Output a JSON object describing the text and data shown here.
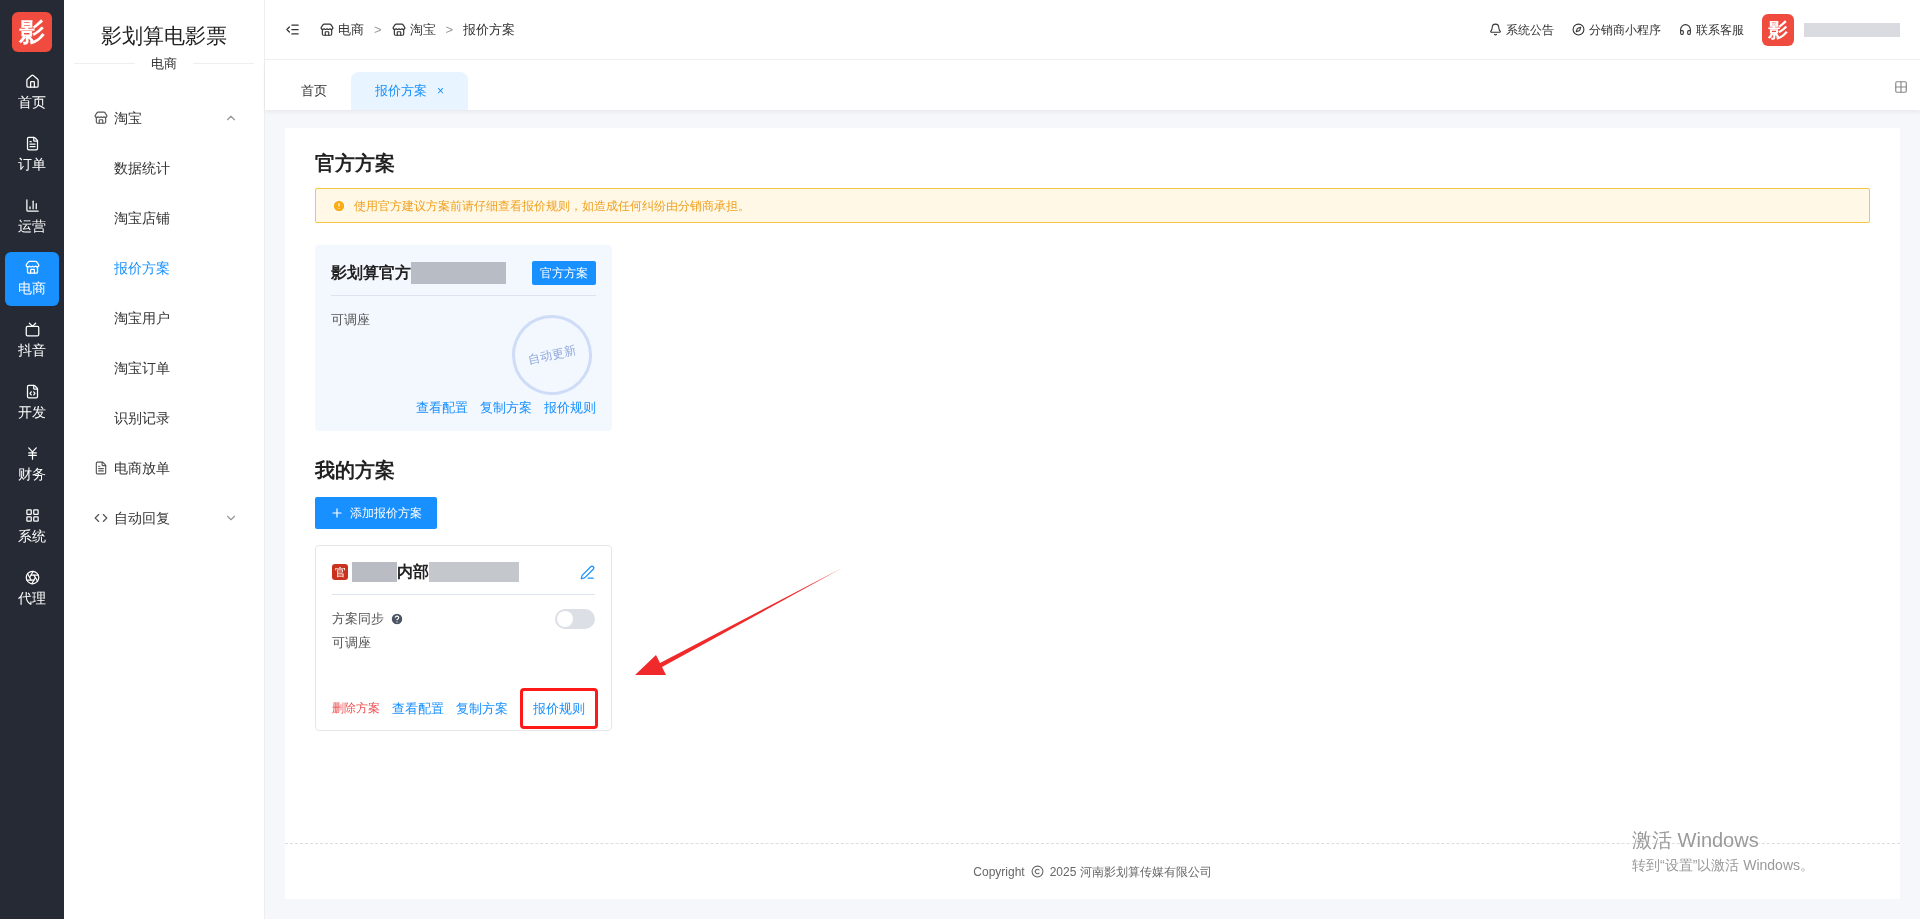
{
  "logo": "影",
  "rail": [
    {
      "label": "首页",
      "selected": false
    },
    {
      "label": "订单",
      "selected": false
    },
    {
      "label": "运营",
      "selected": false
    },
    {
      "label": "电商",
      "selected": true
    },
    {
      "label": "抖音",
      "selected": false
    },
    {
      "label": "开发",
      "selected": false
    },
    {
      "label": "财务",
      "selected": false
    },
    {
      "label": "系统",
      "selected": false
    },
    {
      "label": "代理",
      "selected": false
    }
  ],
  "brand": {
    "title": "影划算电影票",
    "subtitle": "电商"
  },
  "menu": [
    {
      "label": "淘宝",
      "kind": "group",
      "expanded": true,
      "children": [
        {
          "label": "数据统计",
          "selected": false
        },
        {
          "label": "淘宝店铺",
          "selected": false
        },
        {
          "label": "报价方案",
          "selected": true
        },
        {
          "label": "淘宝用户",
          "selected": false
        },
        {
          "label": "淘宝订单",
          "selected": false
        },
        {
          "label": "识别记录",
          "selected": false
        }
      ]
    },
    {
      "label": "电商放单",
      "kind": "link"
    },
    {
      "label": "自动回复",
      "kind": "group",
      "expanded": false
    }
  ],
  "breadcrumb": [
    {
      "label": "电商"
    },
    {
      "separator": ">",
      "label": "淘宝"
    },
    {
      "separator": ">",
      "label": "报价方案"
    }
  ],
  "header_links": [
    {
      "label": "系统公告"
    },
    {
      "label": "分销商小程序"
    },
    {
      "label": "联系客服"
    }
  ],
  "avatar": "影",
  "tabs": [
    {
      "label": "首页",
      "selected": false
    },
    {
      "label": "报价方案",
      "selected": true,
      "close": "×"
    }
  ],
  "official": {
    "heading": "官方方案",
    "alert": "使用官方建议方案前请仔细查看报价规则，如造成任何纠纷由分销商承担。",
    "card": {
      "title": "影划算官方",
      "badge": "官方方案",
      "note": "可调座",
      "stamp": "自动更新",
      "actions": [
        {
          "label": "查看配置",
          "highlighted": false
        },
        {
          "label": "复制方案",
          "highlighted": false
        },
        {
          "label": "报价规则",
          "highlighted": false
        }
      ]
    }
  },
  "mine": {
    "heading": "我的方案",
    "add_button": "添加报价方案",
    "cards": [
      {
        "tag": "官",
        "title": "内部",
        "sync_label": "方案同步",
        "sync_on": false,
        "note": "可调座",
        "delete": "删除方案",
        "actions": [
          {
            "label": "查看配置",
            "highlighted": false
          },
          {
            "label": "复制方案",
            "highlighted": false
          },
          {
            "label": "报价规则",
            "highlighted": true
          }
        ]
      }
    ]
  },
  "footer": {
    "prefix": "Copyright",
    "text": "2025 河南影划算传媒有限公司"
  },
  "os_notice": {
    "title": "激活 Windows",
    "hint": "转到“设置”以激活 Windows。"
  }
}
